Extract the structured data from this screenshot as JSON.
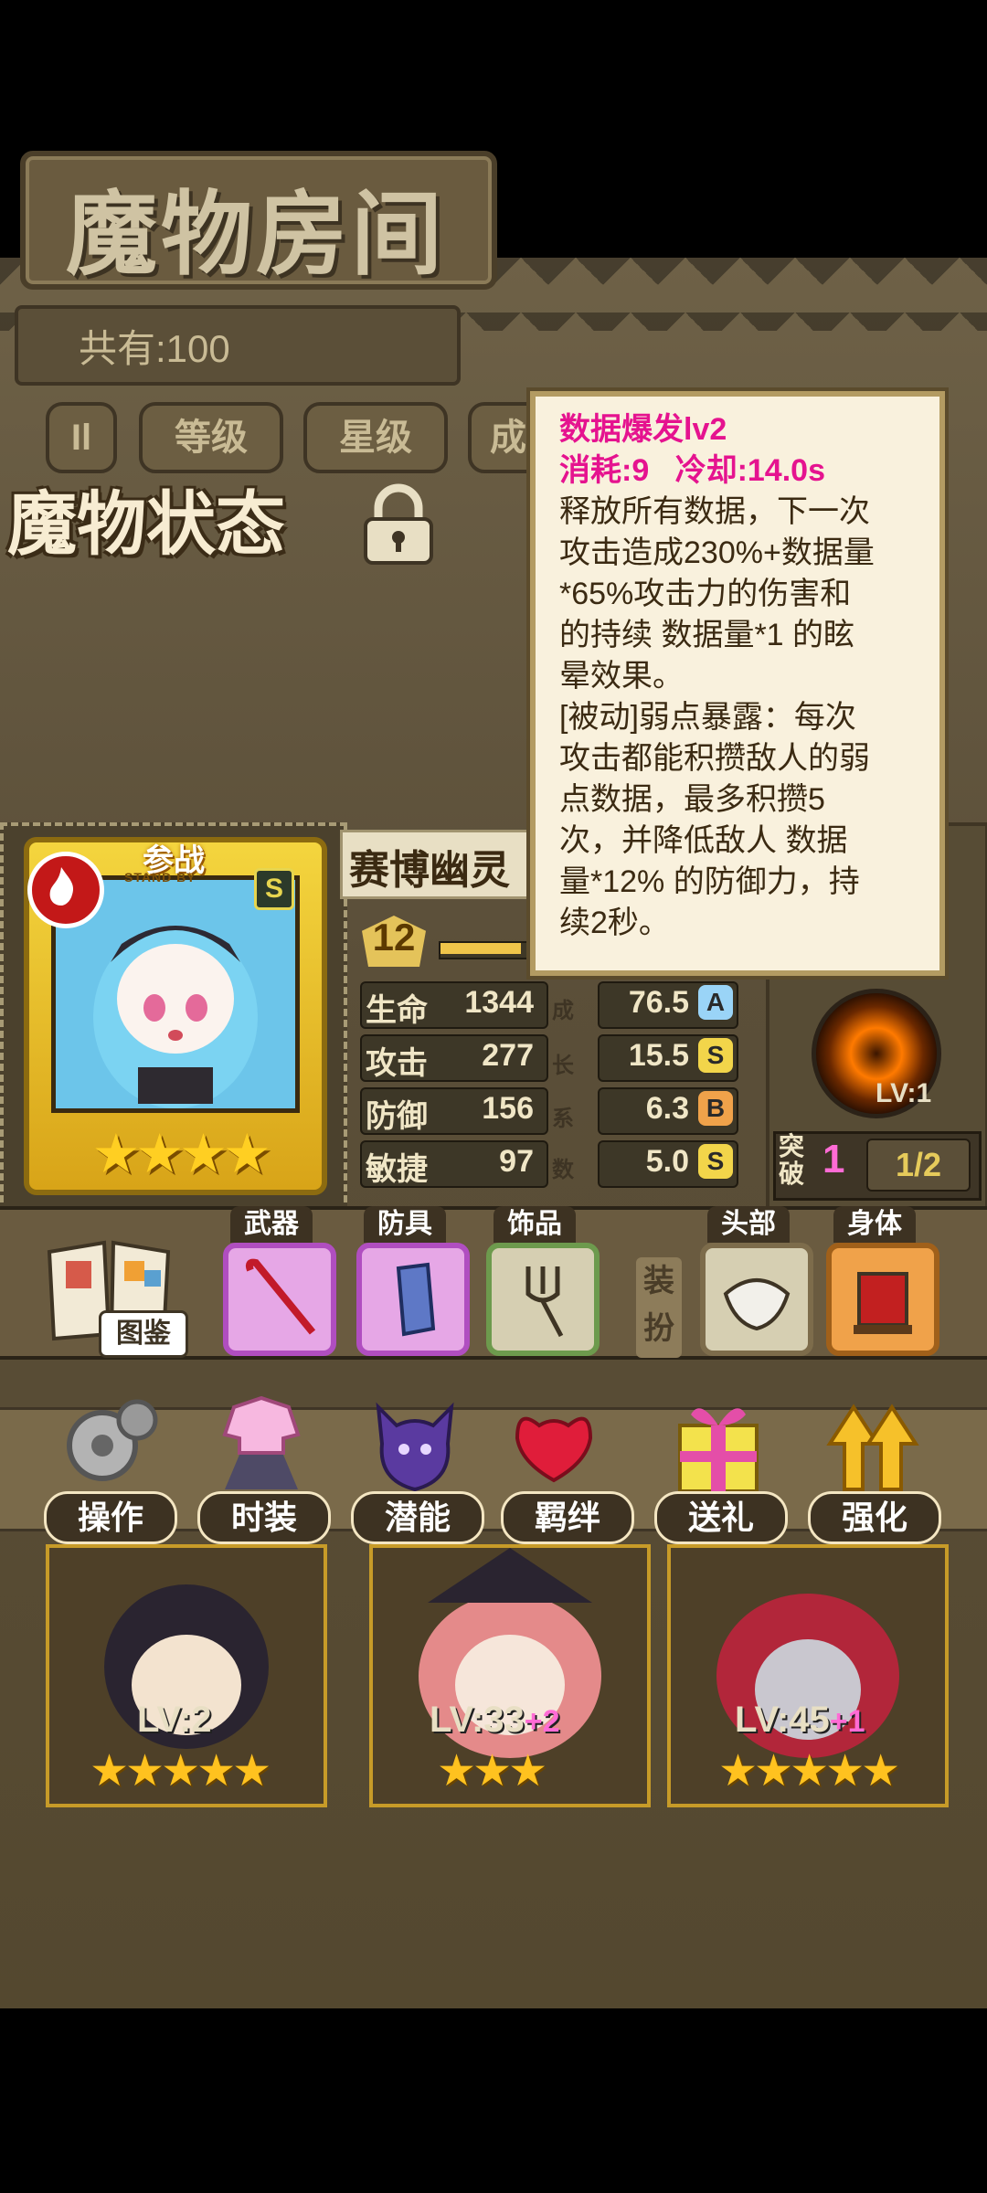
{
  "header": {
    "title": "魔物房间",
    "count_label": "共有:100"
  },
  "filters": {
    "toggle_icon": "Il",
    "tabs": [
      {
        "label": "等级"
      },
      {
        "label": "星级"
      },
      {
        "label": "成"
      }
    ]
  },
  "status_panel": {
    "title": "魔物状态",
    "monster_name": "赛博幽灵",
    "level": "12",
    "card": {
      "standby_label": "参战",
      "standby_sub": "STAND BY",
      "grade": "S",
      "stars": "★★★★"
    },
    "stats": [
      {
        "label": "生命",
        "value": "1344",
        "growth": "76.5",
        "grade": "A"
      },
      {
        "label": "攻击",
        "value": "277",
        "growth": "15.5",
        "grade": "S"
      },
      {
        "label": "防御",
        "value": "156",
        "growth": "6.3",
        "grade": "B"
      },
      {
        "label": "敏捷",
        "value": "97",
        "growth": "5.0",
        "grade": "S"
      }
    ],
    "growth_chars": [
      "成",
      "长",
      "系",
      "数"
    ],
    "orb_level": "LV:1",
    "breakthrough": {
      "label": "突破",
      "count": "1",
      "ratio": "1/2"
    }
  },
  "equipment": {
    "codex_label": "图鉴",
    "weapon_label": "武器",
    "armor_label": "防具",
    "accessory_label": "饰品",
    "outfit_label": "装扮",
    "head_label": "头部",
    "body_label": "身体"
  },
  "actions": [
    {
      "label": "操作"
    },
    {
      "label": "时装"
    },
    {
      "label": "潜能"
    },
    {
      "label": "羁绊"
    },
    {
      "label": "送礼"
    },
    {
      "label": "强化"
    }
  ],
  "roster": [
    {
      "level": "LV:2",
      "plus": "",
      "stars": "★★★★★"
    },
    {
      "level": "LV:33",
      "plus": "+2",
      "stars": "★★★"
    },
    {
      "level": "LV:45",
      "plus": "+1",
      "stars": "★★★★★"
    }
  ],
  "tooltip": {
    "skill_name": "数据爆发lv2",
    "cost_cd": "消耗:9   冷却:14.0s",
    "lines": [
      "释放所有数据，下一次",
      "攻击造成230%+数据量",
      "*65%攻击力的伤害和",
      "的持续 数据量*1 的眩",
      "晕效果。",
      "[被动]弱点暴露：每次",
      "攻击都能积攒敌人的弱",
      "点数据，最多积攒5",
      "次，并降低敌人 数据",
      "量*12% 的防御力，持",
      "续2秒。"
    ]
  }
}
